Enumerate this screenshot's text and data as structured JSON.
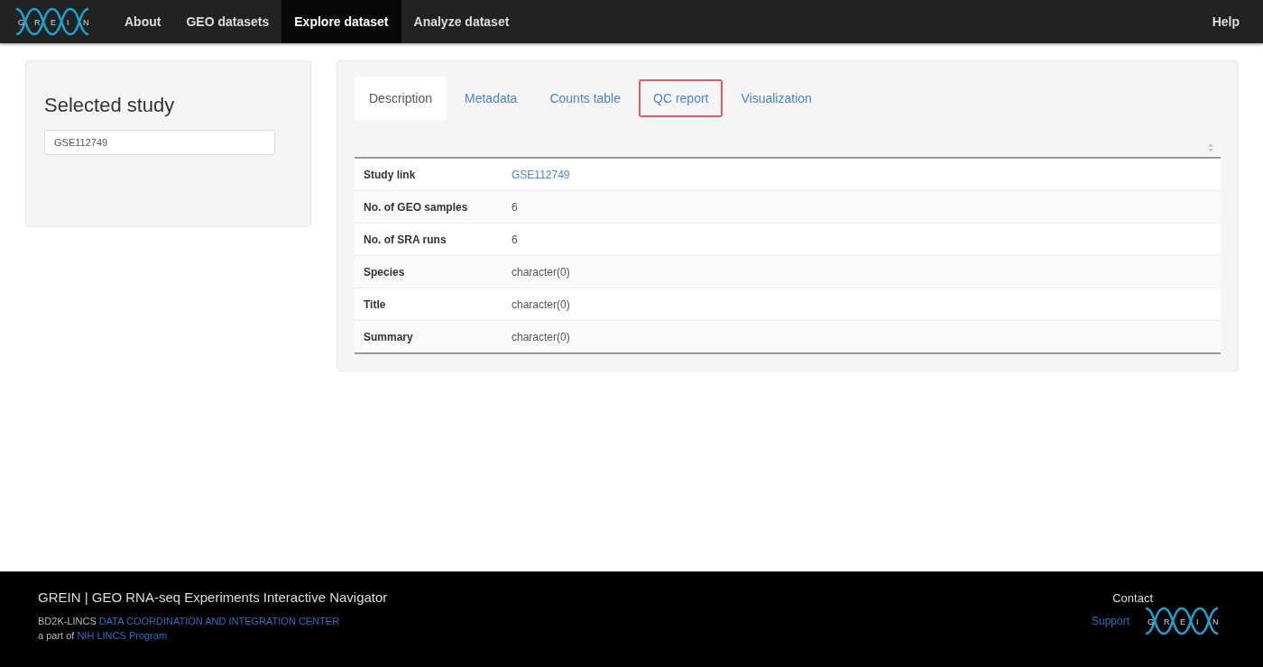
{
  "logo": {
    "letters": [
      "G",
      "R",
      "E",
      "I",
      "N"
    ]
  },
  "nav": {
    "items": [
      {
        "label": "About",
        "selected": false
      },
      {
        "label": "GEO datasets",
        "selected": false
      },
      {
        "label": "Explore dataset",
        "selected": true
      },
      {
        "label": "Analyze dataset",
        "selected": false
      }
    ],
    "right": "Help"
  },
  "sidebar": {
    "title": "Selected study",
    "field_value": "GSE112749"
  },
  "tabs": [
    {
      "label": "Description",
      "selected": true,
      "highlighted": false
    },
    {
      "label": "Metadata",
      "selected": false,
      "highlighted": false
    },
    {
      "label": "Counts table",
      "selected": false,
      "highlighted": false
    },
    {
      "label": "QC report",
      "selected": false,
      "highlighted": true
    },
    {
      "label": "Visualization",
      "selected": false,
      "highlighted": false
    }
  ],
  "table": {
    "rows": [
      {
        "label": "Study link",
        "value": "GSE112749",
        "kind": "link"
      },
      {
        "label": "No. of GEO samples",
        "value": "6",
        "kind": "text"
      },
      {
        "label": "No. of SRA runs",
        "value": "6",
        "kind": "text"
      },
      {
        "label": "Species",
        "value": "character(0)",
        "kind": "text"
      },
      {
        "label": "Title",
        "value": "character(0)",
        "kind": "text"
      },
      {
        "label": "Summary",
        "value": "character(0)",
        "kind": "text"
      }
    ]
  },
  "footer": {
    "title": "GREIN | GEO RNA-seq Experiments Interactive Navigator",
    "line1_prefix": "BD2K-LINCS",
    "line1_link": "DATA COORDINATION AND INTEGRATION CENTER",
    "line2_prefix": "a part of",
    "line2_link": "NIH LINCS Program",
    "contact": "Contact",
    "support": "Support",
    "logo_letters": [
      "G",
      "R",
      "E",
      "I",
      "N"
    ]
  }
}
